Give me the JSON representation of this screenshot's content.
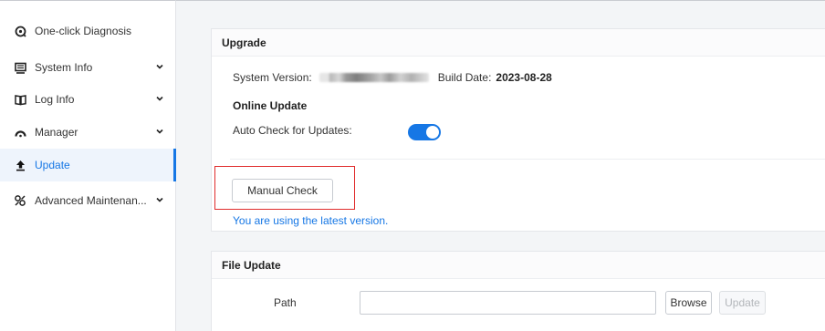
{
  "sidebar": {
    "items": [
      {
        "label": "One-click Diagnosis",
        "icon": "diagnosis-icon",
        "expandable": false
      },
      {
        "label": "System Info",
        "icon": "monitor-icon",
        "expandable": true
      },
      {
        "label": "Log Info",
        "icon": "book-icon",
        "expandable": true
      },
      {
        "label": "Manager",
        "icon": "gauge-icon",
        "expandable": true
      },
      {
        "label": "Update",
        "icon": "upload-icon",
        "expandable": false,
        "active": true
      },
      {
        "label": "Advanced Maintenan...",
        "icon": "maintenance-icon",
        "expandable": true
      }
    ]
  },
  "upgrade": {
    "title": "Upgrade",
    "system_version_label": "System Version:",
    "build_date_label": "Build Date:",
    "build_date": "2023-08-28",
    "online_update_title": "Online Update",
    "auto_check_label": "Auto Check for Updates:",
    "auto_check_enabled": true,
    "manual_check_label": "Manual Check",
    "status_text": "You are using the latest version."
  },
  "file_update": {
    "title": "File Update",
    "path_label": "Path",
    "path_value": "",
    "browse_label": "Browse",
    "update_label": "Update"
  },
  "colors": {
    "accent": "#1677e5",
    "highlight_border": "#e02c2c",
    "content_bg": "#f3f5f7"
  }
}
